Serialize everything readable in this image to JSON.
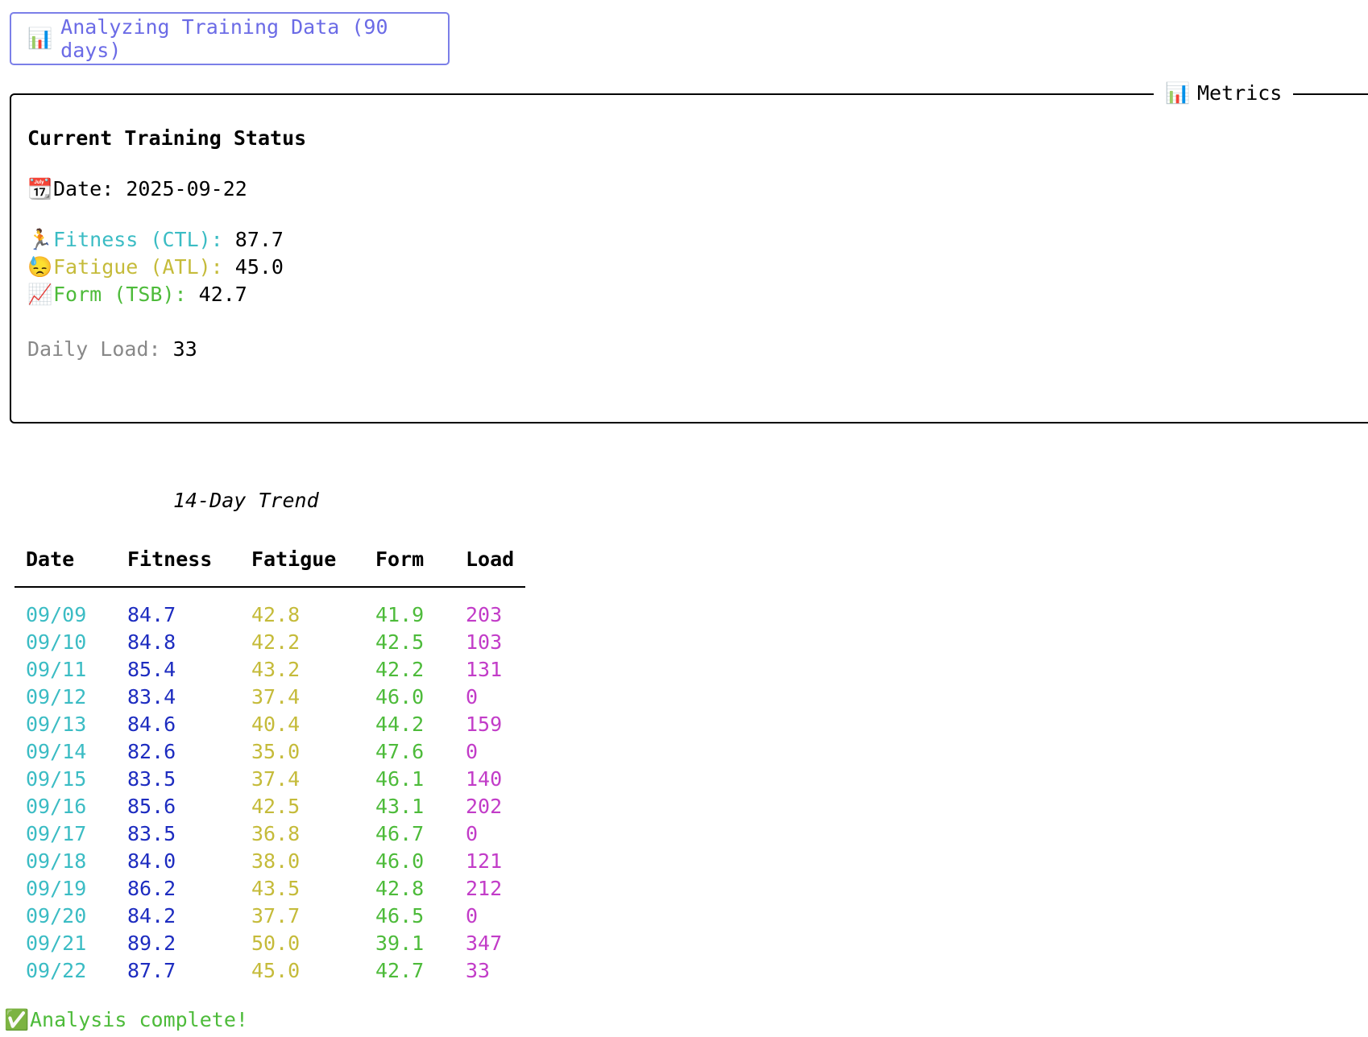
{
  "header": {
    "icon": "bar-chart-icon",
    "text": "Analyzing Training Data (90 days)"
  },
  "metrics_panel": {
    "title_icon": "bar-chart-icon",
    "title": "Metrics",
    "heading": "Current Training Status",
    "date_icon": "calendar-icon",
    "date_label": "Date:",
    "date_value": "2025-09-22",
    "fitness_icon": "runner-icon",
    "fitness_label": "Fitness (CTL):",
    "fitness_value": "87.7",
    "fatigue_icon": "tired-face-icon",
    "fatigue_label": "Fatigue (ATL):",
    "fatigue_value": "45.0",
    "form_icon": "chart-increasing-icon",
    "form_label": "Form (TSB):",
    "form_value": "42.7",
    "load_label": "Daily Load:",
    "load_value": "33"
  },
  "trend": {
    "title": "14-Day Trend",
    "columns": [
      "Date",
      "Fitness",
      "Fatigue",
      "Form",
      "Load"
    ],
    "rows": [
      [
        "09/09",
        "84.7",
        "42.8",
        "41.9",
        "203"
      ],
      [
        "09/10",
        "84.8",
        "42.2",
        "42.5",
        "103"
      ],
      [
        "09/11",
        "85.4",
        "43.2",
        "42.2",
        "131"
      ],
      [
        "09/12",
        "83.4",
        "37.4",
        "46.0",
        "0"
      ],
      [
        "09/13",
        "84.6",
        "40.4",
        "44.2",
        "159"
      ],
      [
        "09/14",
        "82.6",
        "35.0",
        "47.6",
        "0"
      ],
      [
        "09/15",
        "83.5",
        "37.4",
        "46.1",
        "140"
      ],
      [
        "09/16",
        "85.6",
        "42.5",
        "43.1",
        "202"
      ],
      [
        "09/17",
        "83.5",
        "36.8",
        "46.7",
        "0"
      ],
      [
        "09/18",
        "84.0",
        "38.0",
        "46.0",
        "121"
      ],
      [
        "09/19",
        "86.2",
        "43.5",
        "42.8",
        "212"
      ],
      [
        "09/20",
        "84.2",
        "37.7",
        "46.5",
        "0"
      ],
      [
        "09/21",
        "89.2",
        "50.0",
        "39.1",
        "347"
      ],
      [
        "09/22",
        "87.7",
        "45.0",
        "42.7",
        "33"
      ]
    ]
  },
  "status": {
    "icon": "check-mark-icon",
    "text": "Analysis complete!"
  },
  "colors": {
    "header_accent": "#6b6be6",
    "date_col": "#3bbcc4",
    "fitness_col": "#1d2cc0",
    "fatigue_col": "#c5bb3a",
    "form_col": "#4dbb3a",
    "load_col": "#c23cc8"
  }
}
